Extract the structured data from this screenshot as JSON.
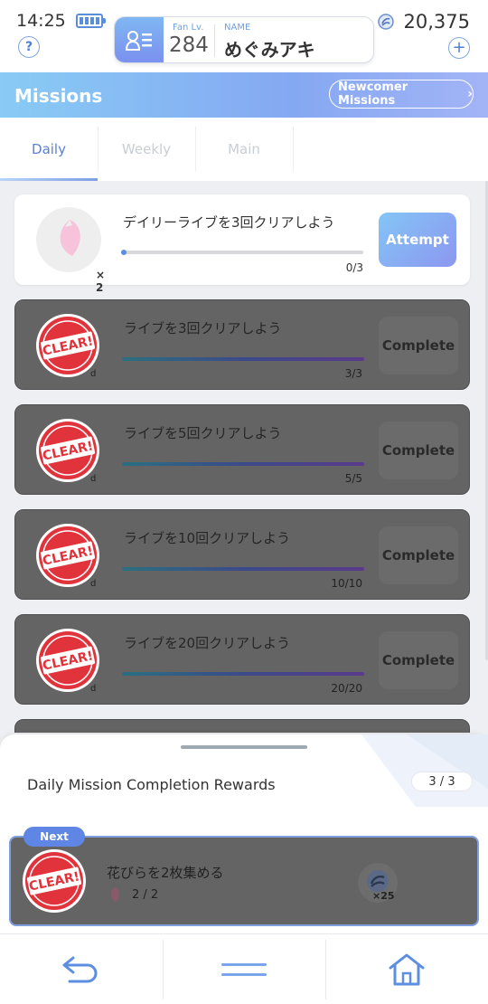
{
  "status": {
    "time": "14:25"
  },
  "profile": {
    "fan_label": "Fan Lv.",
    "fan_level": "284",
    "name_label": "NAME",
    "name": "めぐみアキ"
  },
  "currency": {
    "amount": "20,375",
    "icon": "currency-swirl-icon"
  },
  "header": {
    "title": "Missions",
    "newcomer_label": "Newcomer Missions"
  },
  "tabs": [
    {
      "label": "Daily",
      "active": true
    },
    {
      "label": "Weekly",
      "active": false
    },
    {
      "label": "Main",
      "active": false
    }
  ],
  "missions": [
    {
      "title": "デイリーライブを3回クリアしよう",
      "progress": "0/3",
      "progress_fraction": 0.0,
      "reward_qty": "× 2",
      "button": "Attempt",
      "status": "open"
    },
    {
      "title": "ライブを3回クリアしよう",
      "progress": "3/3",
      "progress_fraction": 1.0,
      "stamp": "CLEAR!",
      "button": "Complete",
      "status": "done"
    },
    {
      "title": "ライブを5回クリアしよう",
      "progress": "5/5",
      "progress_fraction": 1.0,
      "stamp": "CLEAR!",
      "button": "Complete",
      "status": "done"
    },
    {
      "title": "ライブを10回クリアしよう",
      "progress": "10/10",
      "progress_fraction": 1.0,
      "stamp": "CLEAR!",
      "button": "Complete",
      "status": "done"
    },
    {
      "title": "ライブを20回クリアしよう",
      "progress": "20/20",
      "progress_fraction": 1.0,
      "stamp": "CLEAR!",
      "button": "Complete",
      "status": "done"
    }
  ],
  "completion_rewards": {
    "title": "Daily Mission Completion Rewards",
    "count": "3 / 3",
    "next_label": "Next",
    "item": {
      "title": "花びらを2枚集める",
      "progress": "2 / 2",
      "stamp": "CLEAR!",
      "reward_multiplier": "×25"
    }
  },
  "nav": {
    "back_icon": "back-arrow-icon",
    "menu_icon": "menu-icon",
    "home_icon": "home-icon"
  },
  "colors": {
    "accent": "#5a7fd4",
    "header_gradient_start": "#88cbf5",
    "header_gradient_end": "#a3b4f6",
    "done_card": "#646464",
    "stamp_red": "#e0333b"
  }
}
